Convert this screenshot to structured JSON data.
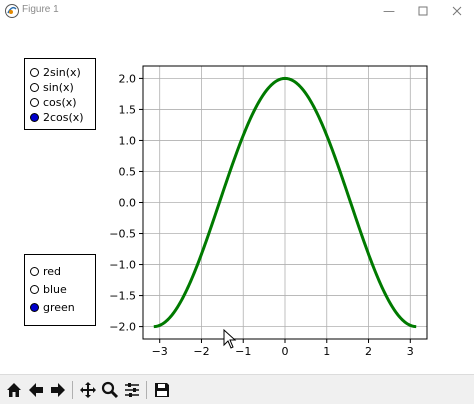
{
  "window": {
    "title": "Figure 1",
    "icons": [
      "app-icon",
      "minimize-icon",
      "maximize-icon",
      "close-icon"
    ]
  },
  "function_selector": {
    "options": [
      "2sin(x)",
      "sin(x)",
      "cos(x)",
      "2cos(x)"
    ],
    "selected": "2cos(x)"
  },
  "color_selector": {
    "options": [
      "red",
      "blue",
      "green"
    ],
    "selected": "green"
  },
  "toolbar": {
    "icons": [
      "home-icon",
      "back-icon",
      "forward-icon",
      "pan-icon",
      "zoom-icon",
      "configure-subplots-icon",
      "save-icon"
    ]
  },
  "chart_data": {
    "type": "line",
    "function": "2cos(x)",
    "x_range": [
      -3.1416,
      3.1416
    ],
    "xlim": [
      -3.4,
      3.4
    ],
    "ylim": [
      -2.2,
      2.2
    ],
    "xticks": [
      -3,
      -2,
      -1,
      0,
      1,
      2,
      3
    ],
    "xtick_labels": [
      "−3",
      "−2",
      "−1",
      "0",
      "1",
      "2",
      "3"
    ],
    "yticks": [
      -2.0,
      -1.5,
      -1.0,
      -0.5,
      0.0,
      0.5,
      1.0,
      1.5,
      2.0
    ],
    "ytick_labels": [
      "−2.0",
      "−1.5",
      "−1.0",
      "−0.5",
      "0.0",
      "0.5",
      "1.0",
      "1.5",
      "2.0"
    ],
    "grid": true,
    "series": [
      {
        "line_color": "#007a00",
        "x": [
          -3.1416,
          -2.8,
          -2.4,
          -2.0,
          -1.6,
          -1.2,
          -0.8,
          -0.4,
          0.0,
          0.4,
          0.8,
          1.2,
          1.6,
          2.0,
          2.4,
          2.8,
          3.1416
        ],
        "y": [
          -2.0,
          -1.884,
          -1.475,
          -0.832,
          -0.058,
          0.725,
          1.393,
          1.842,
          2.0,
          1.842,
          1.393,
          0.725,
          -0.058,
          -0.832,
          -1.475,
          -1.884,
          -2.0
        ]
      }
    ]
  }
}
